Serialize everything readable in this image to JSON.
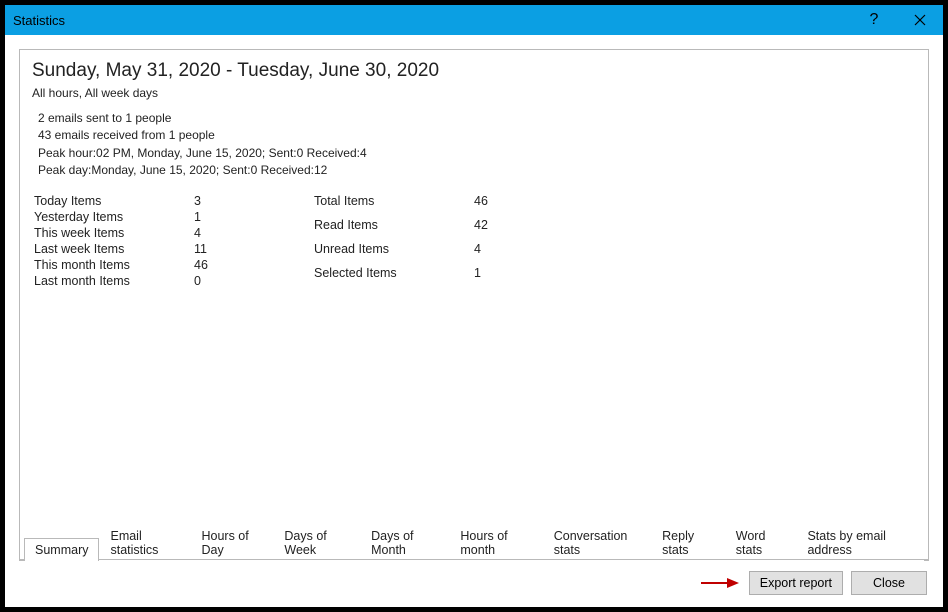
{
  "window": {
    "title": "Statistics"
  },
  "header": {
    "dateRange": "Sunday, May 31, 2020 - Tuesday, June 30, 2020",
    "filter": "All hours, All week days"
  },
  "info": {
    "line1": "2 emails sent to 1 people",
    "line2": "43 emails received from 1 people",
    "line3": "Peak hour:02 PM, Monday, June 15, 2020; Sent:0 Received:4",
    "line4": "Peak day:Monday, June 15, 2020; Sent:0 Received:12"
  },
  "statsLeft": [
    {
      "label": "Today Items",
      "value": "3"
    },
    {
      "label": "Yesterday Items",
      "value": "1"
    },
    {
      "label": "This week Items",
      "value": "4"
    },
    {
      "label": "Last week Items",
      "value": "11"
    },
    {
      "label": "This month Items",
      "value": "46"
    },
    {
      "label": "Last month Items",
      "value": "0"
    }
  ],
  "statsRight": [
    {
      "label": "Total Items",
      "value": "46"
    },
    {
      "label": "Read Items",
      "value": "42"
    },
    {
      "label": "Unread Items",
      "value": "4"
    },
    {
      "label": "Selected Items",
      "value": "1"
    }
  ],
  "tabs": [
    "Summary",
    "Email statistics",
    "Hours of Day",
    "Days of Week",
    "Days of Month",
    "Hours of month",
    "Conversation stats",
    "Reply stats",
    "Word stats",
    "Stats by email address"
  ],
  "activeTab": "Summary",
  "buttons": {
    "export": "Export report",
    "close": "Close"
  },
  "colors": {
    "titlebar": "#0b9fe3",
    "arrow": "#c00000"
  }
}
